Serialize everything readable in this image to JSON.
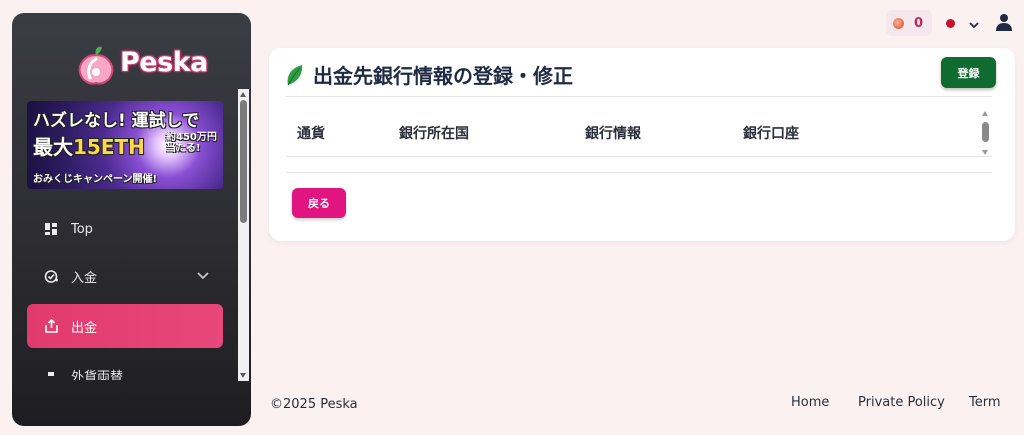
{
  "brand": {
    "name": "Pesk",
    "name_tail": "a"
  },
  "banner": {
    "line1": "ハズレなし! 運試しで",
    "line2_prefix": "最大",
    "line2_highlight": "15ETH",
    "side_line1": "約450万円",
    "side_line2": "当たる!",
    "line3": "おみくじキャンペーン開催!"
  },
  "sidebar": {
    "items": [
      {
        "label": "Top",
        "icon": "dashboard-icon"
      },
      {
        "label": "入金",
        "icon": "deposit-icon",
        "has_submenu": true
      },
      {
        "label": "出金",
        "icon": "withdraw-icon",
        "active": true
      },
      {
        "label": "外貨両替",
        "icon": "exchange-icon"
      }
    ]
  },
  "header": {
    "coin_count": "0",
    "language_flag": "red-dot-flag-icon"
  },
  "main": {
    "title": "出金先銀行情報の登録・修正",
    "register_button": "登録",
    "back_button": "戻る",
    "table": {
      "headers": [
        "通貨",
        "銀行所在国",
        "銀行情報",
        "銀行口座"
      ],
      "rows": []
    }
  },
  "footer": {
    "copyright": "©2025 Peska",
    "links": [
      "Home",
      "Private Policy",
      "Term"
    ]
  },
  "colors": {
    "accent_pink": "#e0157f",
    "active_nav": "#e23a6c",
    "register_green": "#0f6b2f",
    "page_bg": "#fcf1f1"
  }
}
